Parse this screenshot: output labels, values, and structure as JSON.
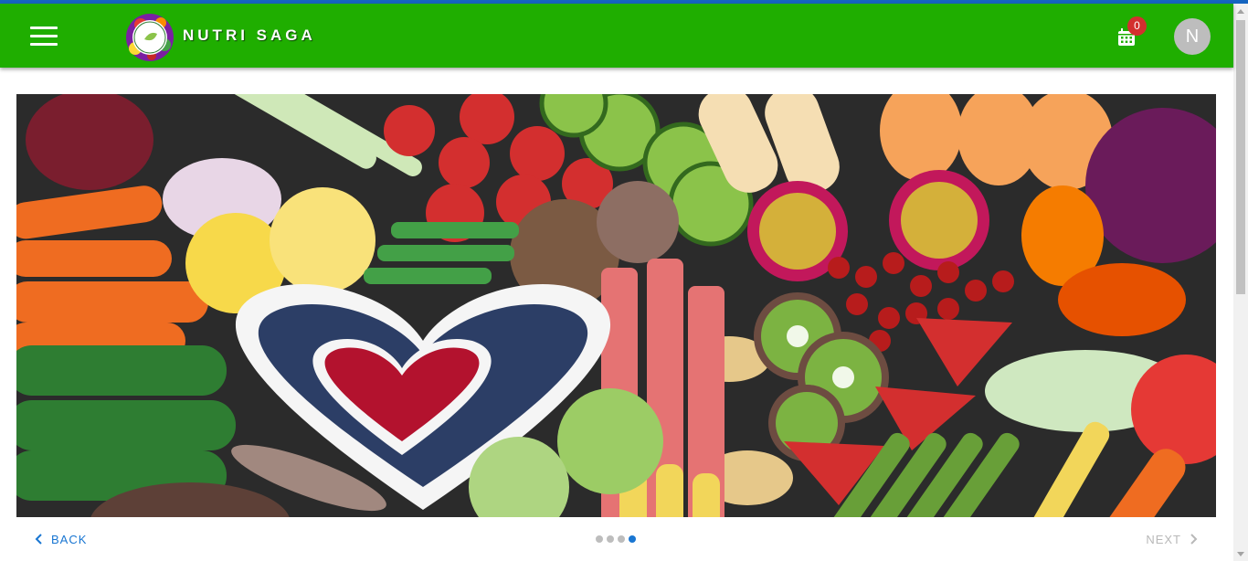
{
  "header": {
    "menu_icon": "hamburger-menu-icon",
    "brand": "NUTRI SAGA",
    "logo_icon": "nutri-saga-logo",
    "calendar_icon": "calendar-icon",
    "badge_count": "0",
    "avatar_initial": "N",
    "bar_color": "#1fae00"
  },
  "hero": {
    "image": "assorted-fruits-vegetables-photo"
  },
  "stepper": {
    "back_label": "BACK",
    "next_label": "NEXT",
    "steps_total": 4,
    "active_step": 4,
    "accent": "#1976d2"
  }
}
